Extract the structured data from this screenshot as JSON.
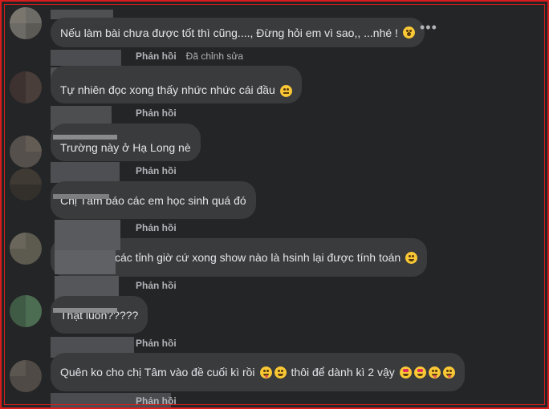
{
  "colors": {
    "background": "#242526",
    "bubble": "#3a3b3c",
    "text": "#e4e6eb",
    "secondary_text": "#b0b3b8",
    "frame_border": "#d81c1c"
  },
  "more_icon": "more-horizontal-icon",
  "comments": [
    {
      "text": "Nếu làm bài chưa được tốt thì cũng...., Đừng hỏi em vì sao,, ...nhé !",
      "emojis": [
        "face-with-hand-over-mouth"
      ],
      "reply": "Phản hồi",
      "edited": "Đã chỉnh sửa"
    },
    {
      "text": "Tự nhiên đọc xong thấy nhức nhức cái đầu",
      "emojis": [
        "flushed-face"
      ],
      "reply": "Phản hồi"
    },
    {
      "text": "Trường này ở Hạ Long nè",
      "emojis": [],
      "reply": "Phản hồi"
    },
    {
      "text": "Chị Tâm báo các em học sinh quá đó",
      "emojis": [],
      "reply": "Phản hồi"
    },
    {
      "text": "các tỉnh giờ cứ xong show nào là hsinh lại được tính toán",
      "emojis": [
        "grinning-squinting-face"
      ],
      "reply": "Phản hồi"
    },
    {
      "text": "Thật luôn?????",
      "emojis": [],
      "reply": "Phản hồi"
    },
    {
      "text": "Quên ko cho chị Tâm vào đề cuối kì rồi",
      "text2": "thôi để dành kì 2 vậy",
      "emojis": [
        "winking-face-with-tongue",
        "rolling-on-floor-laughing"
      ],
      "emojis2": [
        "star-struck",
        "star-struck",
        "winking-face-with-tongue",
        "winking-face-with-tongue"
      ],
      "reply": "Phản hồi"
    }
  ],
  "last_reply": "Phản hồi"
}
